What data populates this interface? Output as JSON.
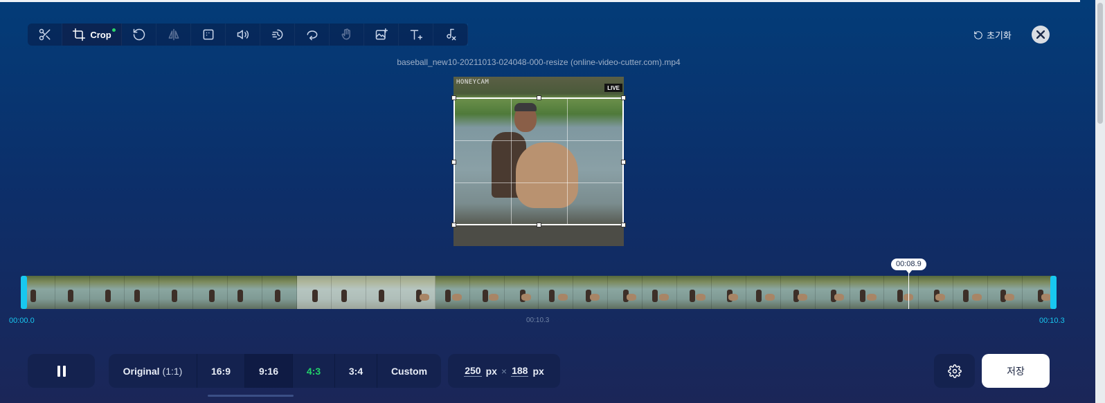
{
  "toolbar": {
    "crop_label": "Crop",
    "tools": [
      "scissors-icon",
      "crop-icon",
      "rotate-icon",
      "flip-icon",
      "grid-icon",
      "volume-icon",
      "speed-icon",
      "loop-icon",
      "stabilize-icon",
      "image-add-icon",
      "text-add-icon",
      "audio-remove-icon"
    ]
  },
  "header": {
    "reset_label": "초기화",
    "filename": "baseball_new10-20211013-024048-000-resize (online-video-cutter.com).mp4"
  },
  "video": {
    "watermark": "HONEYCAM",
    "live_badge": "LIVE"
  },
  "timeline": {
    "current_time": "00:08.9",
    "start_time": "00:00.0",
    "duration_mid": "00:10.3",
    "end_time": "00:10.3"
  },
  "controls": {
    "ratios": [
      {
        "label": "Original",
        "sub": "(1:1)"
      },
      {
        "label": "16:9"
      },
      {
        "label": "9:16"
      },
      {
        "label": "4:3"
      },
      {
        "label": "3:4"
      },
      {
        "label": "Custom"
      }
    ],
    "width_value": "250",
    "height_value": "188",
    "unit": "px",
    "times_sign": "×",
    "save_label": "저장"
  },
  "colors": {
    "accent_cyan": "#18c8f0",
    "accent_green": "#22d36a",
    "bg_top": "#033c78",
    "bg_bottom": "#1b2658"
  }
}
